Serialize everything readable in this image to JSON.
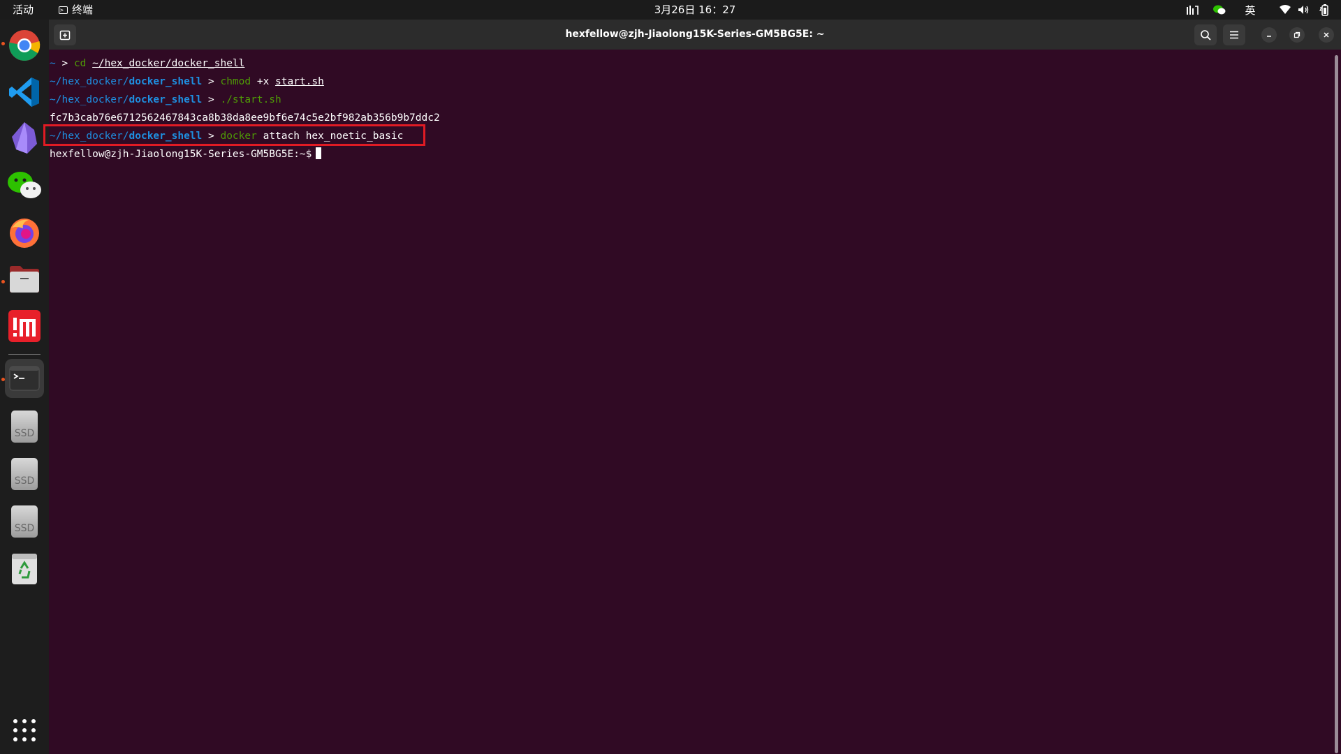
{
  "topbar": {
    "activities": "活动",
    "app_name": "终端",
    "clock": "3月26日  16：27",
    "input_method": "英"
  },
  "dock": {
    "apps": [
      {
        "name": "chrome"
      },
      {
        "name": "vscode"
      },
      {
        "name": "obsidian"
      },
      {
        "name": "wechat"
      },
      {
        "name": "firefox"
      },
      {
        "name": "files"
      },
      {
        "name": "mathworks"
      },
      {
        "name": "terminal"
      }
    ],
    "drives": [
      "SSD",
      "SSD",
      "SSD"
    ],
    "trash_label": "trash"
  },
  "window": {
    "title": "hexfellow@zjh-Jiaolong15K-Series-GM5BG5E: ~"
  },
  "terminal": {
    "lines": [
      {
        "prompt_dir": "~",
        "prompt_bold": "",
        "sep": " > ",
        "cmd": "cd",
        "args": "~/hex_docker/docker_shell",
        "args_ul": true
      },
      {
        "prompt_dir": "~/hex_docker/",
        "prompt_bold": "docker_shell",
        "sep": " > ",
        "cmd": "chmod",
        "args_plain": " +x ",
        "args": "start.sh",
        "args_ul": true
      },
      {
        "prompt_dir": "~/hex_docker/",
        "prompt_bold": "docker_shell",
        "sep": " > ",
        "cmd": "./start.sh"
      },
      {
        "output": "fc7b3cab76e6712562467843ca8b38da8ee9bf6e74c5e2bf982ab356b9b7ddc2"
      },
      {
        "prompt_dir": "~/hex_docker/",
        "prompt_bold": "docker_shell",
        "sep": " > ",
        "cmd": "docker",
        "args_plain": " attach hex_noetic_basic"
      },
      {
        "output": "hexfellow@zjh-Jiaolong15K-Series-GM5BG5E:~$"
      }
    ]
  },
  "colors": {
    "terminal_bg": "#300a24",
    "prompt_blue": "#1e8fe0",
    "command_green": "#4e9a06",
    "highlight_red": "#e01b24"
  }
}
